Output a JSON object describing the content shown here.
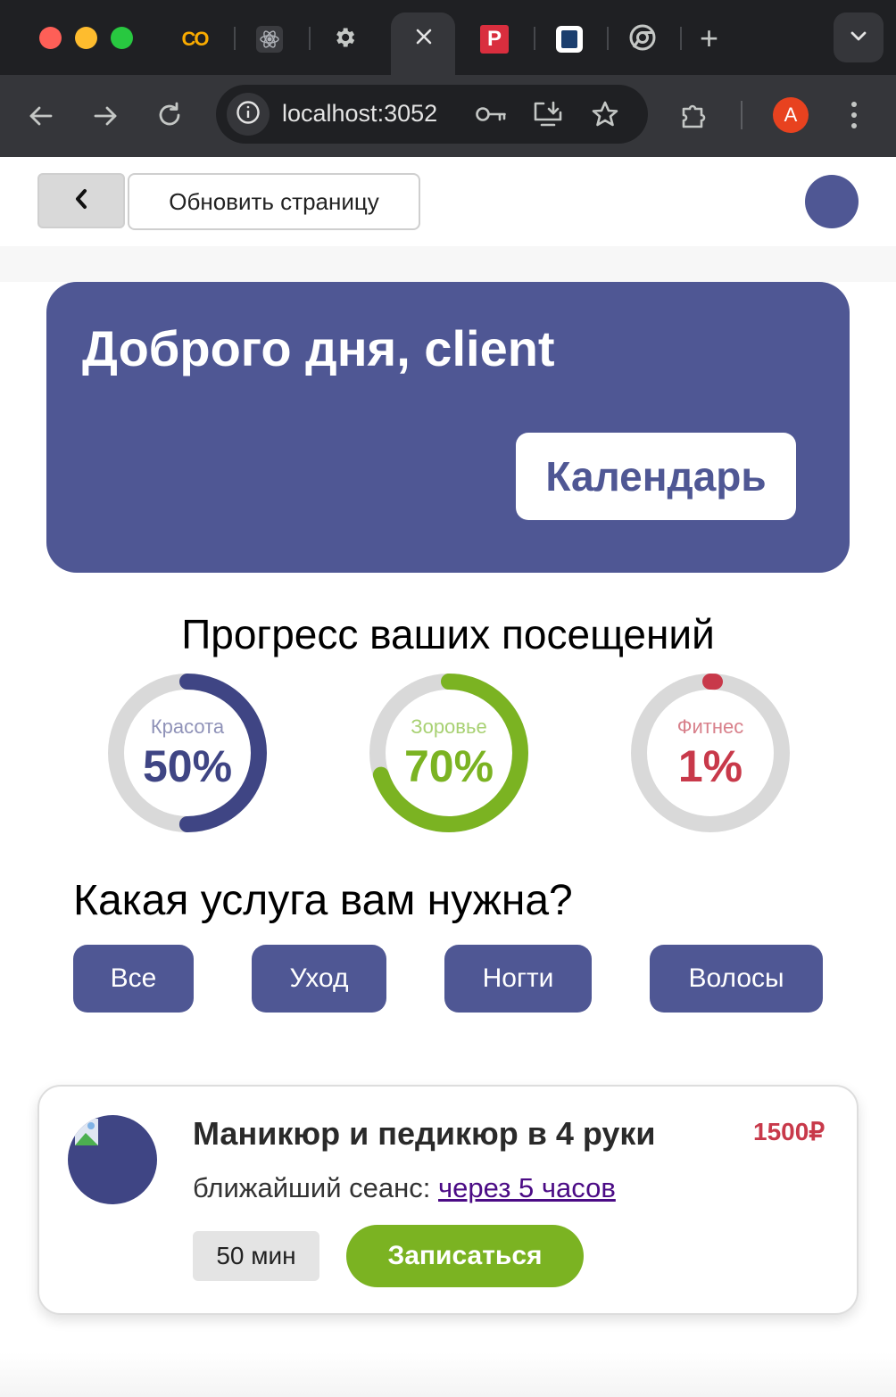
{
  "browser": {
    "tabs": [
      {
        "icon": "colab-icon"
      },
      {
        "icon": "react-icon"
      },
      {
        "icon": "settings-icon"
      },
      {
        "icon": "close-icon",
        "active": true
      },
      {
        "icon": "app-red-icon"
      },
      {
        "icon": "book-icon"
      },
      {
        "icon": "chrome-icon"
      }
    ],
    "new_tab_label": "+",
    "url": "localhost:3052",
    "profile_initial": "A"
  },
  "header": {
    "back_label": "<",
    "refresh_label": "Обновить страницу"
  },
  "hero": {
    "greeting": "Доброго дня, client",
    "calendar_label": "Календарь"
  },
  "progress": {
    "title": "Прогресс ваших посещений",
    "items": [
      {
        "label": "Красота",
        "value": "50%",
        "percent": 50,
        "color": "#3f4584",
        "label_color": "#8f92b8"
      },
      {
        "label": "Зоровье",
        "value": "70%",
        "percent": 70,
        "color": "#7bb322",
        "label_color": "#a8d173"
      },
      {
        "label": "Фитнес",
        "value": "1%",
        "percent": 1,
        "color": "#c8394a",
        "label_color": "#d8808b"
      }
    ]
  },
  "services": {
    "title": "Какая услуга вам нужна?",
    "filters": [
      "Все",
      "Уход",
      "Ногти",
      "Волосы"
    ]
  },
  "card": {
    "title": "Маникюр и педикюр в 4 руки",
    "price": "1500₽",
    "session_prefix": "ближайший сеанс: ",
    "session_link": "через 5 часов",
    "duration": "50 мин",
    "book_label": "Записаться"
  },
  "colors": {
    "primary": "#4f5794",
    "green": "#7bb322",
    "red": "#c8394a",
    "ring_track": "#d9d9d9"
  }
}
